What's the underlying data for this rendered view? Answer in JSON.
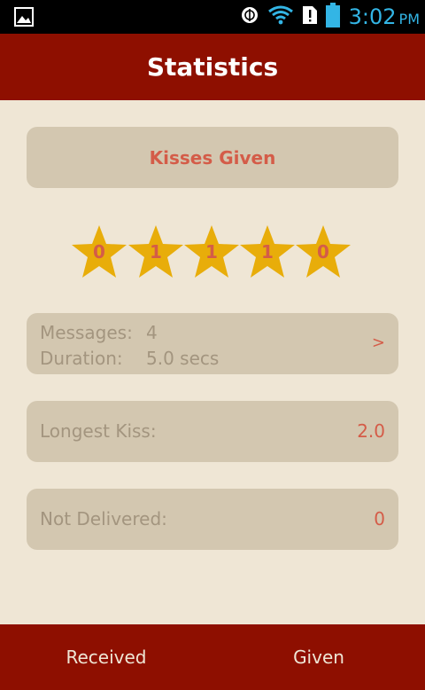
{
  "status_bar": {
    "time": "3:02",
    "ampm": "PM",
    "icons": [
      "gallery-icon",
      "sync-icon",
      "wifi-icon",
      "alert-icon",
      "battery-icon"
    ]
  },
  "header": {
    "title": "Statistics"
  },
  "section": {
    "title": "Kisses Given"
  },
  "stars": {
    "color": "#e8ad0a",
    "values": [
      "0",
      "1",
      "1",
      "1",
      "0"
    ]
  },
  "summary": {
    "messages_label": "Messages:",
    "messages_value": "4",
    "duration_label": "Duration:",
    "duration_value": "5.0 secs",
    "arrow": ">"
  },
  "longest": {
    "label": "Longest Kiss:",
    "value": "2.0"
  },
  "not_delivered": {
    "label": "Not Delivered:",
    "value": "0"
  },
  "bottom_nav": {
    "received": "Received",
    "given": "Given"
  },
  "colors": {
    "header_bg": "#8e0f00",
    "background": "#efe6d5",
    "card_bg": "#d3c7b0",
    "accent": "#d45c48",
    "label": "#a3957f",
    "status_icon": "#33b5e5"
  }
}
